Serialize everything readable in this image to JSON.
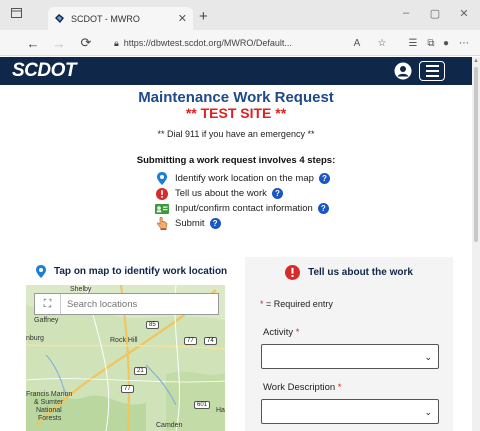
{
  "browser": {
    "tab_title": "SCDOT - MWRO",
    "new_tab": "+",
    "url": "https://dbwtest.scdot.org/MWRO/Default...",
    "minimize": "–",
    "maximize": "▢",
    "close": "✕"
  },
  "header": {
    "logo": "SCDOT"
  },
  "intro": {
    "title": "Maintenance Work Request",
    "test_site": "** TEST SITE **",
    "emergency": "** Dial 911 if you have an emergency **",
    "steps_heading": "Submitting a work request involves 4 steps:",
    "steps": [
      {
        "label": "Identify work location on the map",
        "icon": "map-pin-icon"
      },
      {
        "label": "Tell us about the work",
        "icon": "exclamation-icon"
      },
      {
        "label": "Input/confirm contact information",
        "icon": "contact-card-icon"
      },
      {
        "label": "Submit",
        "icon": "pointer-hand-icon"
      }
    ]
  },
  "map_panel": {
    "heading": "Tap on map to identify work location",
    "search_placeholder": "Search locations",
    "labels": [
      "Shelby",
      "Gaffney",
      "Rock Hill",
      "Francis Marion",
      "& Sumter",
      "National",
      "Forests",
      "Camden",
      "nburg",
      "Ha"
    ],
    "shields": [
      "85",
      "77",
      "74",
      "21",
      "601",
      "77"
    ]
  },
  "work_panel": {
    "heading": "Tell us about the work",
    "required_star": "*",
    "required_text": "= Required entry",
    "activity_label": "Activity",
    "description_label": "Work Description"
  },
  "colors": {
    "header_bg": "#0f2748",
    "title": "#1f4a8a",
    "test_red": "#e02020",
    "help_blue": "#1a56c6"
  }
}
